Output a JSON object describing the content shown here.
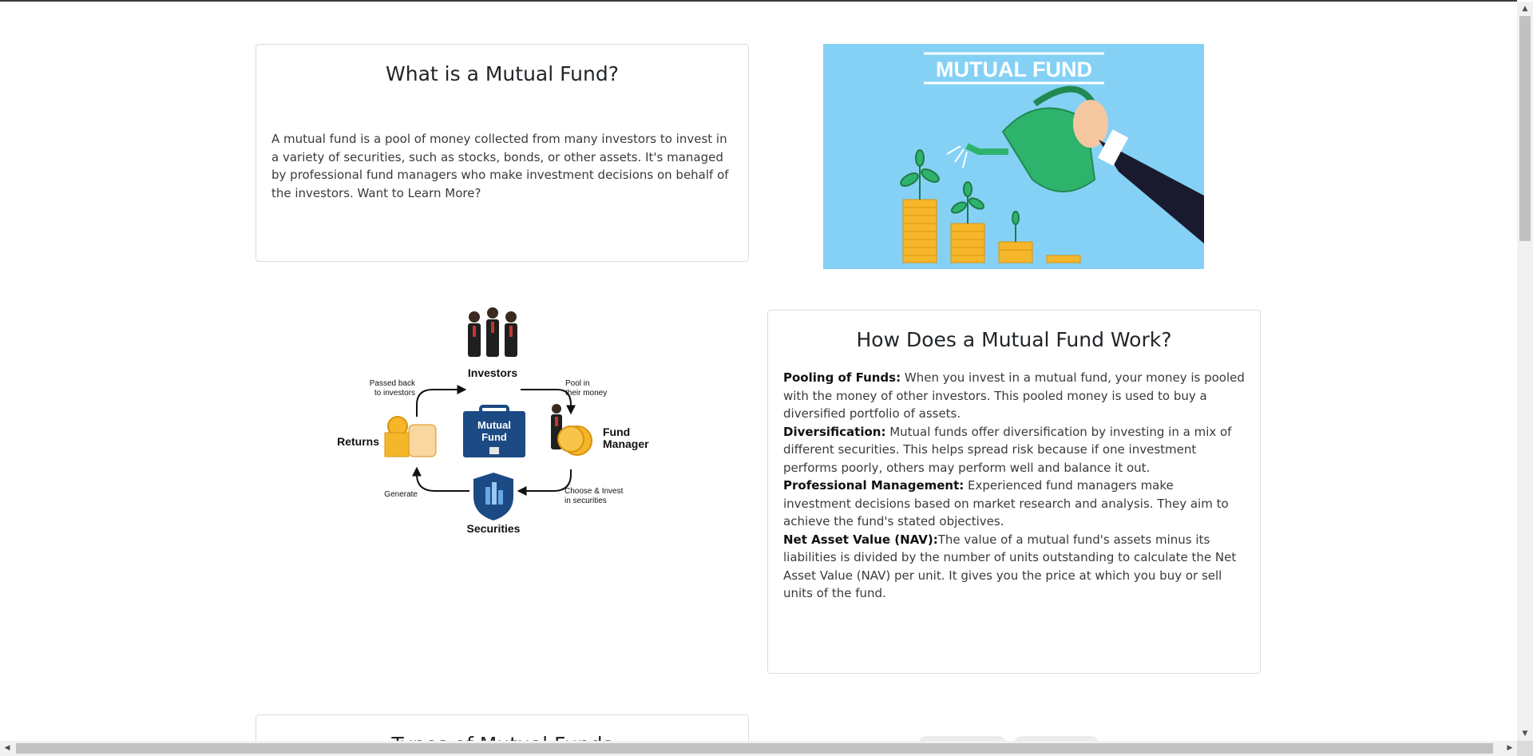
{
  "what_card": {
    "title": "What is a Mutual Fund?",
    "text": "A mutual fund is a pool of money collected from many investors to invest in a variety of securities, such as stocks, bonds, or other assets. It's managed by professional fund managers who make investment decisions on behalf of the investors. Want to Learn More?"
  },
  "hero_image": {
    "banner_text": "MUTUAL FUND"
  },
  "diagram": {
    "investors": "Investors",
    "pool_line1": "Pool in",
    "pool_line2": "their money",
    "passed_line1": "Passed back",
    "passed_line2": "to investors",
    "center_line1": "Mutual",
    "center_line2": "Fund",
    "returns": "Returns",
    "fund_manager_line1": "Fund",
    "fund_manager_line2": "Manager",
    "generate": "Generate",
    "choose_line1": "Choose & Invest",
    "choose_line2": "in securities",
    "securities": "Securities"
  },
  "how_card": {
    "title": "How Does a Mutual Fund Work?",
    "items": [
      {
        "label": "Pooling of Funds:",
        "text": " When you invest in a mutual fund, your money is pooled with the money of other investors. This pooled money is used to buy a diversified portfolio of assets."
      },
      {
        "label": "Diversification:",
        "text": " Mutual funds offer diversification by investing in a mix of different securities. This helps spread risk because if one investment performs poorly, others may perform well and balance it out."
      },
      {
        "label": "Professional Management:",
        "text": " Experienced fund managers make investment decisions based on market research and analysis. They aim to achieve the fund's stated objectives."
      },
      {
        "label": "Net Asset Value (NAV):",
        "text": "The value of a mutual fund's assets minus its liabilities is divided by the number of units outstanding to calculate the Net Asset Value (NAV) per unit. It gives you the price at which you buy or sell units of the fund."
      }
    ]
  },
  "types_card": {
    "title": "Types of Mutual Funds"
  },
  "colors": {
    "hero_bg": "#84d1f5",
    "navy": "#1b4a84",
    "coin": "#f6b62a",
    "green": "#2eb36c"
  }
}
